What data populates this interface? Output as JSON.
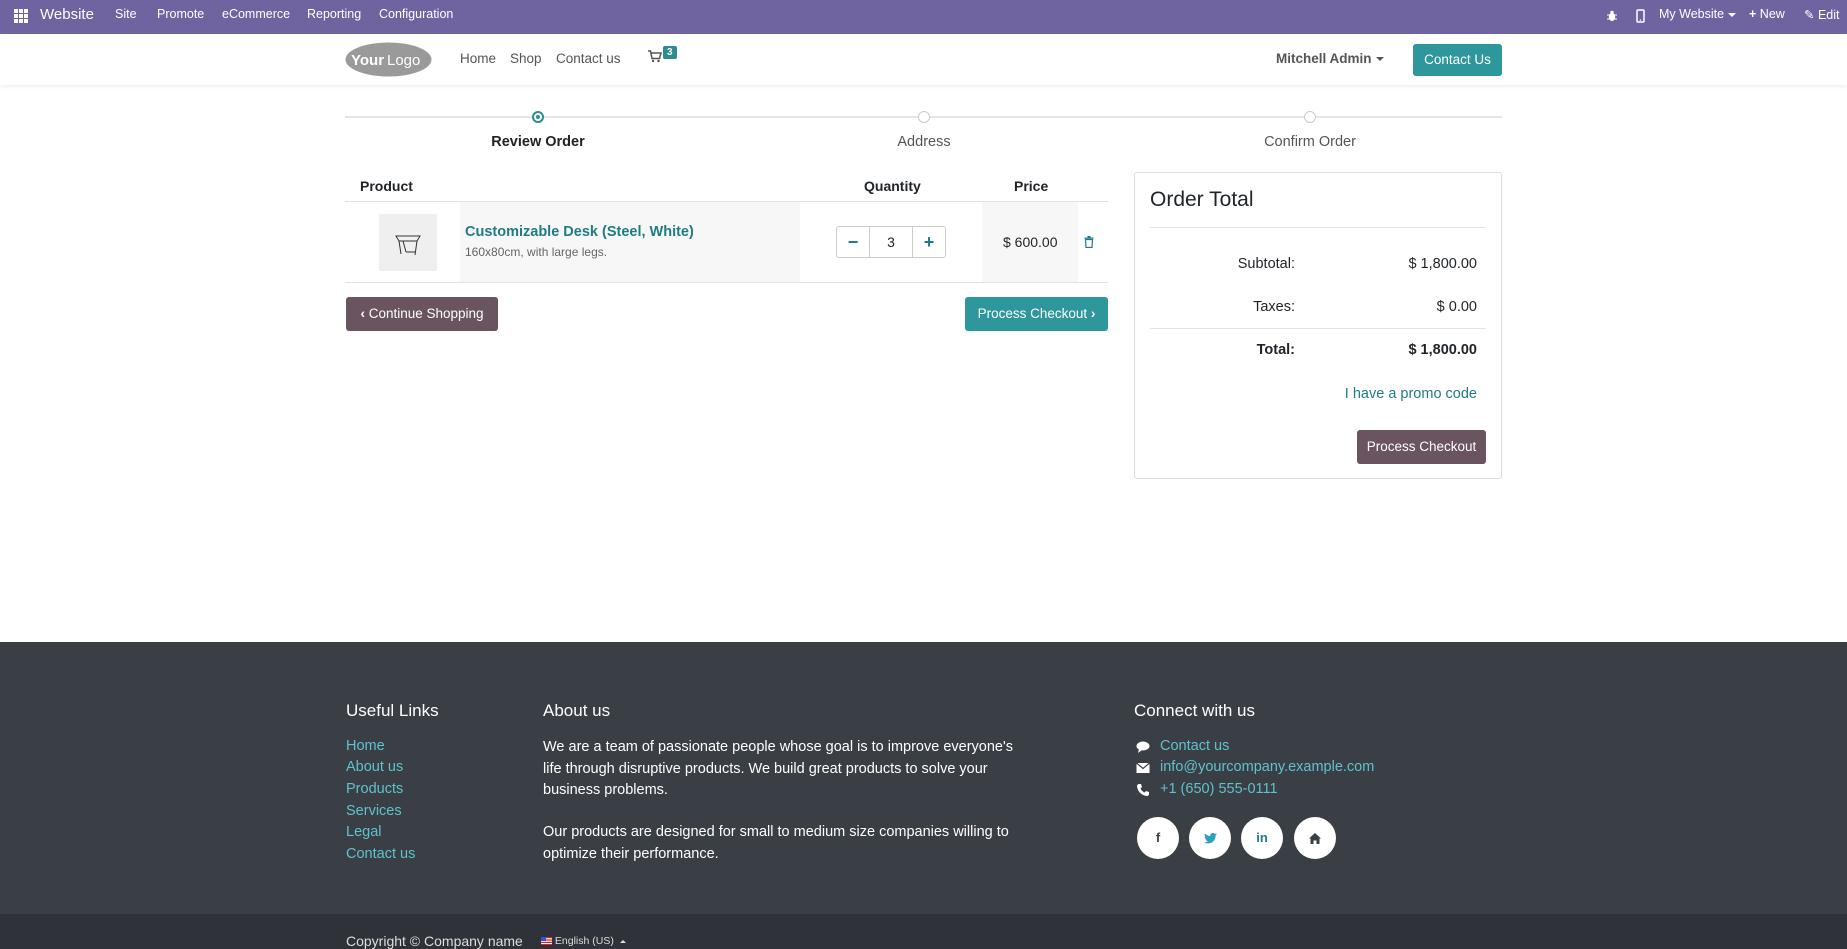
{
  "adminbar": {
    "brand": "Website",
    "menu": [
      "Site",
      "Promote",
      "eCommerce",
      "Reporting",
      "Configuration"
    ],
    "my_website": "My Website",
    "new_label": "New",
    "edit_label": "Edit",
    "bg_color": "#6f63a0"
  },
  "header": {
    "logo_text": "YourLogo",
    "nav": [
      "Home",
      "Shop",
      "Contact us"
    ],
    "cart_count": "3",
    "user": "Mitchell Admin",
    "contact_button": "Contact Us"
  },
  "progress": {
    "steps": [
      "Review Order",
      "Address",
      "Confirm Order"
    ],
    "active_step": 0
  },
  "cart": {
    "columns": {
      "product": "Product",
      "quantity": "Quantity",
      "price": "Price"
    },
    "items": [
      {
        "name": "Customizable Desk (Steel, White)",
        "description": "160x80cm, with large legs.",
        "quantity": "3",
        "price": "$ 600.00"
      }
    ],
    "continue_label": "Continue Shopping",
    "checkout_label": "Process Checkout"
  },
  "order_total": {
    "title": "Order Total",
    "subtotal_label": "Subtotal:",
    "subtotal": "$ 1,800.00",
    "taxes_label": "Taxes:",
    "taxes": "$ 0.00",
    "total_label": "Total:",
    "total": "$ 1,800.00",
    "promo": "I have a promo code",
    "checkout_label": "Process Checkout"
  },
  "footer": {
    "useful_links_title": "Useful Links",
    "useful_links": [
      "Home",
      "About us",
      "Products",
      "Services",
      "Legal",
      "Contact us"
    ],
    "about_title": "About us",
    "about_p1": "We are a team of passionate people whose goal is to improve everyone's life through disruptive products. We build great products to solve your business problems.",
    "about_p2": "Our products are designed for small to medium size companies willing to optimize their performance.",
    "connect_title": "Connect with us",
    "contact_link": "Contact us",
    "email": "info@yourcompany.example.com",
    "phone": "+1 (650) 555-0111",
    "copyright": "Copyright © Company name",
    "language": "English (US)"
  }
}
